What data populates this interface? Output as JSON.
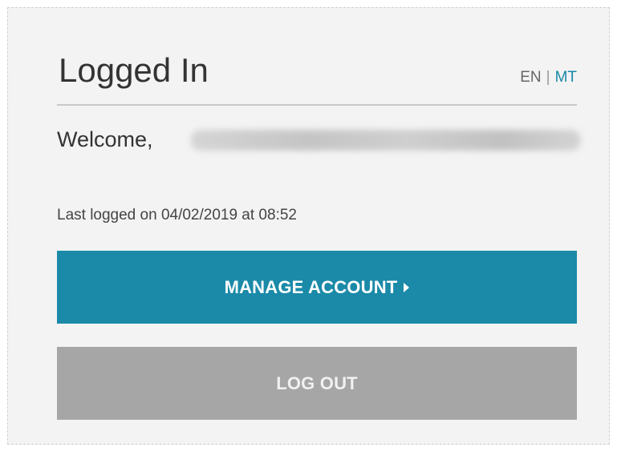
{
  "header": {
    "title": "Logged In",
    "languages": [
      "EN",
      "MT"
    ],
    "separator": "|"
  },
  "welcome": {
    "label": "Welcome,",
    "user_name_redacted": true
  },
  "session": {
    "last_logged_text": "Last logged on 04/02/2019 at 08:52"
  },
  "actions": {
    "manage_account_label": "MANAGE ACCOUNT",
    "manage_account_icon": "caret-right-icon",
    "logout_label": "LOG OUT"
  },
  "colors": {
    "primary": "#1a8aa8",
    "secondary_button": "#a6a6a6",
    "panel_bg": "#f3f3f3",
    "text": "#333333"
  }
}
